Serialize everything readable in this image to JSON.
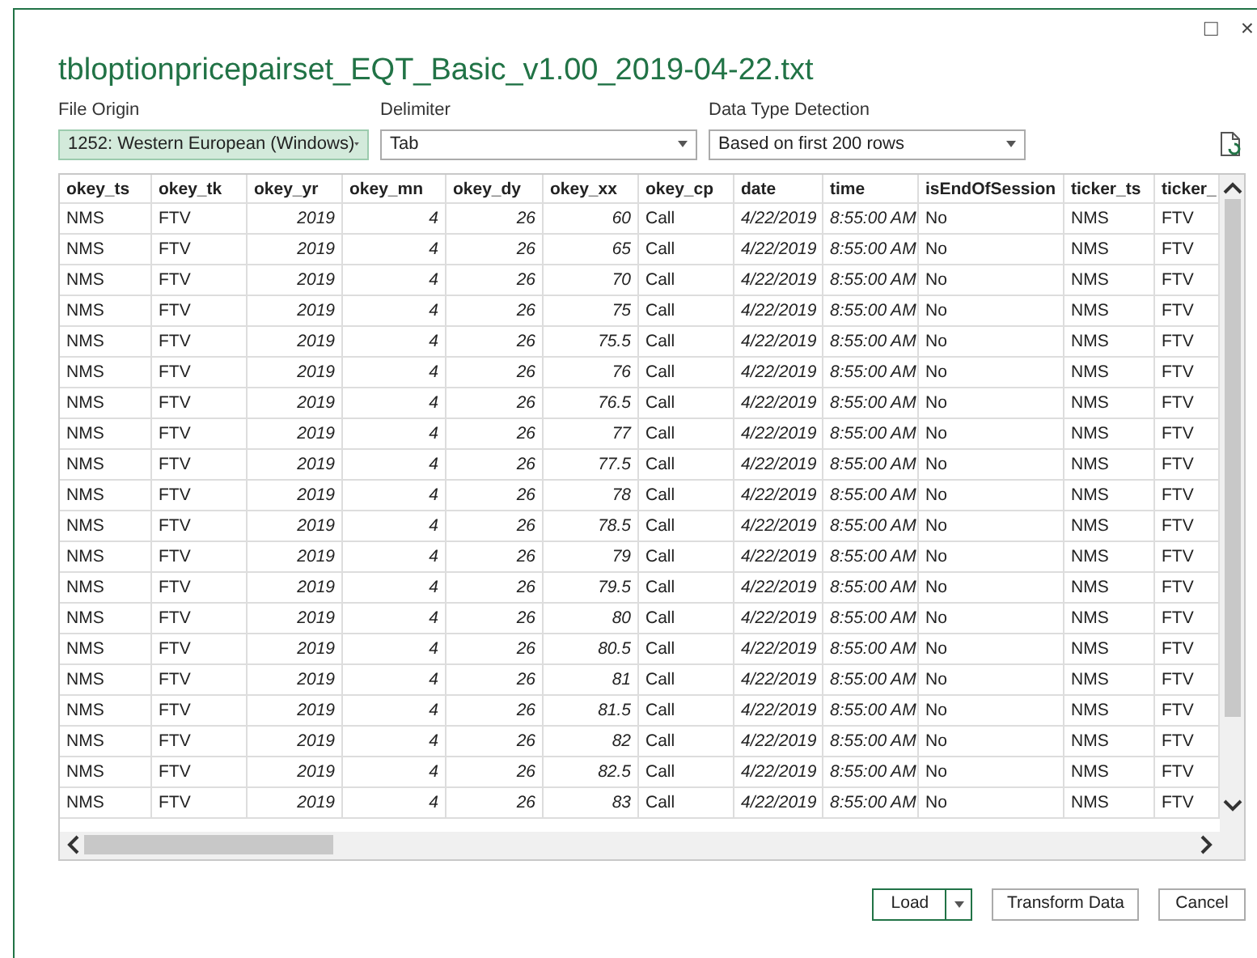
{
  "window": {
    "title": "tbloptionpricepairset_EQT_Basic_v1.00_2019-04-22.txt",
    "controls": [
      "□",
      "×"
    ]
  },
  "options": [
    {
      "label": "File Origin",
      "value": "1252: Western European (Windows)",
      "highlighted": true
    },
    {
      "label": "Delimiter",
      "value": "Tab",
      "highlighted": false
    },
    {
      "label": "Data Type Detection",
      "value": "Based on first 200 rows",
      "highlighted": false
    }
  ],
  "table": {
    "columns": [
      {
        "name": "okey_ts",
        "kind": "text"
      },
      {
        "name": "okey_tk",
        "kind": "text"
      },
      {
        "name": "okey_yr",
        "kind": "number"
      },
      {
        "name": "okey_mn",
        "kind": "number"
      },
      {
        "name": "okey_dy",
        "kind": "number"
      },
      {
        "name": "okey_xx",
        "kind": "number"
      },
      {
        "name": "okey_cp",
        "kind": "text"
      },
      {
        "name": "date",
        "kind": "number"
      },
      {
        "name": "time",
        "kind": "number"
      },
      {
        "name": "isEndOfSession",
        "kind": "text"
      },
      {
        "name": "ticker_ts",
        "kind": "text"
      },
      {
        "name": "ticker_",
        "kind": "text"
      }
    ],
    "rows": [
      [
        "NMS",
        "FTV",
        "2019",
        "4",
        "26",
        "60",
        "Call",
        "4/22/2019",
        "8:55:00 AM",
        "No",
        "NMS",
        "FTV"
      ],
      [
        "NMS",
        "FTV",
        "2019",
        "4",
        "26",
        "65",
        "Call",
        "4/22/2019",
        "8:55:00 AM",
        "No",
        "NMS",
        "FTV"
      ],
      [
        "NMS",
        "FTV",
        "2019",
        "4",
        "26",
        "70",
        "Call",
        "4/22/2019",
        "8:55:00 AM",
        "No",
        "NMS",
        "FTV"
      ],
      [
        "NMS",
        "FTV",
        "2019",
        "4",
        "26",
        "75",
        "Call",
        "4/22/2019",
        "8:55:00 AM",
        "No",
        "NMS",
        "FTV"
      ],
      [
        "NMS",
        "FTV",
        "2019",
        "4",
        "26",
        "75.5",
        "Call",
        "4/22/2019",
        "8:55:00 AM",
        "No",
        "NMS",
        "FTV"
      ],
      [
        "NMS",
        "FTV",
        "2019",
        "4",
        "26",
        "76",
        "Call",
        "4/22/2019",
        "8:55:00 AM",
        "No",
        "NMS",
        "FTV"
      ],
      [
        "NMS",
        "FTV",
        "2019",
        "4",
        "26",
        "76.5",
        "Call",
        "4/22/2019",
        "8:55:00 AM",
        "No",
        "NMS",
        "FTV"
      ],
      [
        "NMS",
        "FTV",
        "2019",
        "4",
        "26",
        "77",
        "Call",
        "4/22/2019",
        "8:55:00 AM",
        "No",
        "NMS",
        "FTV"
      ],
      [
        "NMS",
        "FTV",
        "2019",
        "4",
        "26",
        "77.5",
        "Call",
        "4/22/2019",
        "8:55:00 AM",
        "No",
        "NMS",
        "FTV"
      ],
      [
        "NMS",
        "FTV",
        "2019",
        "4",
        "26",
        "78",
        "Call",
        "4/22/2019",
        "8:55:00 AM",
        "No",
        "NMS",
        "FTV"
      ],
      [
        "NMS",
        "FTV",
        "2019",
        "4",
        "26",
        "78.5",
        "Call",
        "4/22/2019",
        "8:55:00 AM",
        "No",
        "NMS",
        "FTV"
      ],
      [
        "NMS",
        "FTV",
        "2019",
        "4",
        "26",
        "79",
        "Call",
        "4/22/2019",
        "8:55:00 AM",
        "No",
        "NMS",
        "FTV"
      ],
      [
        "NMS",
        "FTV",
        "2019",
        "4",
        "26",
        "79.5",
        "Call",
        "4/22/2019",
        "8:55:00 AM",
        "No",
        "NMS",
        "FTV"
      ],
      [
        "NMS",
        "FTV",
        "2019",
        "4",
        "26",
        "80",
        "Call",
        "4/22/2019",
        "8:55:00 AM",
        "No",
        "NMS",
        "FTV"
      ],
      [
        "NMS",
        "FTV",
        "2019",
        "4",
        "26",
        "80.5",
        "Call",
        "4/22/2019",
        "8:55:00 AM",
        "No",
        "NMS",
        "FTV"
      ],
      [
        "NMS",
        "FTV",
        "2019",
        "4",
        "26",
        "81",
        "Call",
        "4/22/2019",
        "8:55:00 AM",
        "No",
        "NMS",
        "FTV"
      ],
      [
        "NMS",
        "FTV",
        "2019",
        "4",
        "26",
        "81.5",
        "Call",
        "4/22/2019",
        "8:55:00 AM",
        "No",
        "NMS",
        "FTV"
      ],
      [
        "NMS",
        "FTV",
        "2019",
        "4",
        "26",
        "82",
        "Call",
        "4/22/2019",
        "8:55:00 AM",
        "No",
        "NMS",
        "FTV"
      ],
      [
        "NMS",
        "FTV",
        "2019",
        "4",
        "26",
        "82.5",
        "Call",
        "4/22/2019",
        "8:55:00 AM",
        "No",
        "NMS",
        "FTV"
      ],
      [
        "NMS",
        "FTV",
        "2019",
        "4",
        "26",
        "83",
        "Call",
        "4/22/2019",
        "8:55:00 AM",
        "No",
        "NMS",
        "FTV"
      ]
    ]
  },
  "buttons": [
    {
      "label": "Load",
      "kind": "split"
    },
    {
      "label": "Transform Data",
      "kind": "plain"
    },
    {
      "label": "Cancel",
      "kind": "plain"
    }
  ]
}
